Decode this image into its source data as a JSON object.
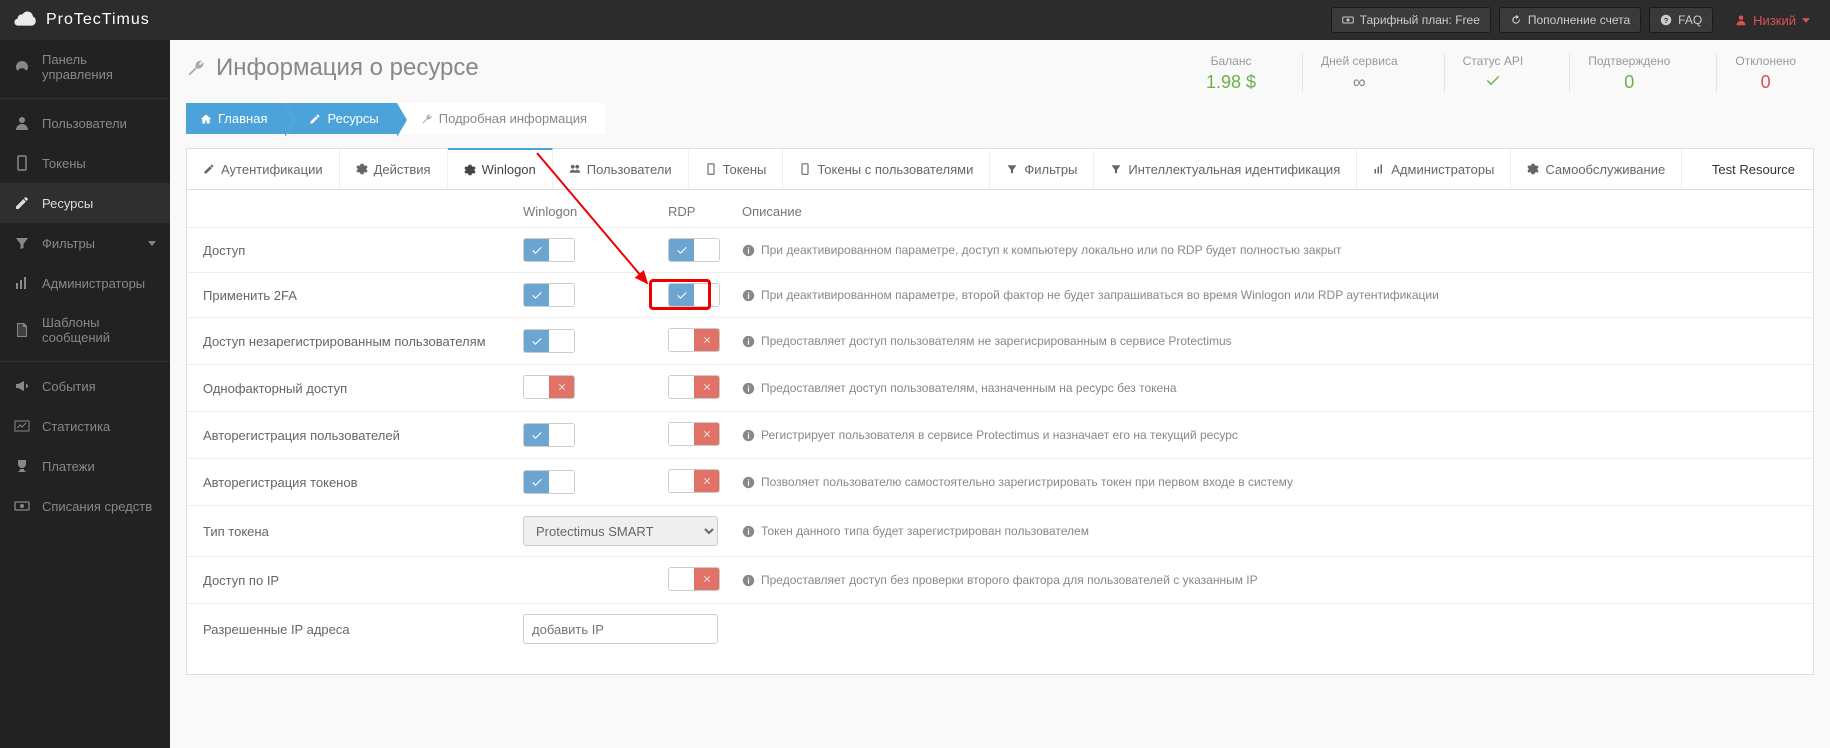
{
  "logo_text": "ProTecTimus",
  "topbar": {
    "tariff": "Тарифный план: Free",
    "refill": "Пополнение счета",
    "faq": "FAQ",
    "user": "Низкий"
  },
  "sidebar": [
    {
      "icon": "dashboard",
      "label": "Панель управления"
    },
    {
      "icon": "user",
      "label": "Пользователи"
    },
    {
      "icon": "tablet",
      "label": "Токены"
    },
    {
      "icon": "edit",
      "label": "Ресурсы",
      "active": true
    },
    {
      "icon": "filter",
      "label": "Фильтры"
    },
    {
      "icon": "bars",
      "label": "Администраторы"
    },
    {
      "icon": "file",
      "label": "Шаблоны сообщений"
    },
    {
      "icon": "bullhorn",
      "label": "События"
    },
    {
      "icon": "stats",
      "label": "Статистика"
    },
    {
      "icon": "trophy",
      "label": "Платежи"
    },
    {
      "icon": "money",
      "label": "Списания средств"
    }
  ],
  "page_title": "Информация о ресурсе",
  "stats": {
    "balance_label": "Баланс",
    "balance_val": "1.98 $",
    "days_label": "Дней сервиса",
    "days_val": "∞",
    "api_label": "Статус API",
    "confirmed_label": "Подтверждено",
    "confirmed_val": "0",
    "rejected_label": "Отклонено",
    "rejected_val": "0"
  },
  "breadcrumb": {
    "home": "Главная",
    "resources": "Ресурсы",
    "detail": "Подробная информация"
  },
  "tabs": {
    "auth": "Аутентификации",
    "actions": "Действия",
    "winlogon": "Winlogon",
    "users": "Пользователи",
    "tokens": "Токены",
    "tokens_users": "Токены с пользователями",
    "filters": "Фильтры",
    "intel": "Интеллектуальная идентификация",
    "admins": "Администраторы",
    "selfservice": "Самообслуживание",
    "resource_name": "Test Resource"
  },
  "headers": {
    "winlogon": "Winlogon",
    "rdp": "RDP",
    "desc": "Описание"
  },
  "rows": {
    "access": {
      "label": "Доступ",
      "desc": "При деактивированном параметре, доступ к компьютеру локально или по RDP будет полностью закрыт"
    },
    "apply2fa": {
      "label": "Применить 2FA",
      "desc": "При деактивированном параметре, второй фактор не будет запрашиваться во время Winlogon или RDP аутентификации"
    },
    "unreg": {
      "label": "Доступ незарегистрированным пользователям",
      "desc": "Предоставляет доступ пользователям не зарегисрированным в сервисе Protectimus"
    },
    "onefactor": {
      "label": "Однофакторный доступ",
      "desc": "Предоставляет доступ пользователям, назначенным на ресурс без токена"
    },
    "autoreg_users": {
      "label": "Авторегистрация пользователей",
      "desc": "Регистрирует пользователя в сервисе Protectimus и назначает его на текущий ресурс"
    },
    "autoreg_tokens": {
      "label": "Авторегистрация токенов",
      "desc": "Позволяет пользователю самостоятельно зарегистрировать токен при первом входе в систему"
    },
    "token_type": {
      "label": "Тип токена",
      "value": "Protectimus SMART",
      "desc": "Токен данного типа будет зарегистрирован пользователем"
    },
    "ip_access": {
      "label": "Доступ по IP",
      "desc": "Предоставляет доступ без проверки второго фактора для пользователей с указанным IP"
    },
    "allowed_ip": {
      "label": "Разрешенные IP адреса",
      "placeholder": "добавить IP"
    }
  }
}
